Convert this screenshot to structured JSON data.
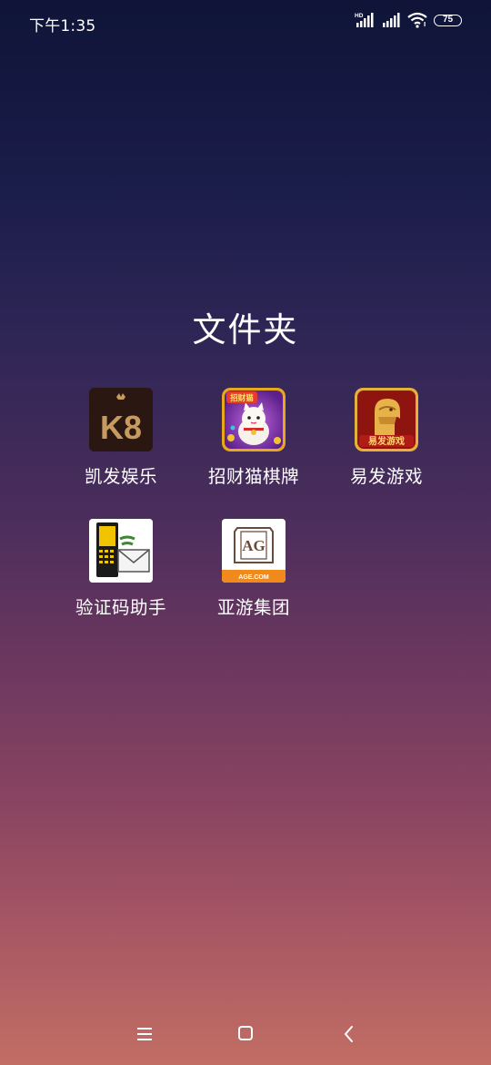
{
  "status_bar": {
    "time": "下午1:35",
    "network_label": "HD",
    "battery_level": "75",
    "icons": [
      "signal-hd-icon",
      "signal-icon",
      "wifi-icon",
      "battery-icon"
    ]
  },
  "folder": {
    "title": "文件夹",
    "apps": [
      {
        "label": "凯发娱乐",
        "icon": "k8-icon"
      },
      {
        "label": "招财猫棋牌",
        "icon": "lucky-cat-icon"
      },
      {
        "label": "易发游戏",
        "icon": "lion-icon"
      },
      {
        "label": "验证码助手",
        "icon": "sms-phone-icon"
      },
      {
        "label": "亚游集团",
        "icon": "ag-icon"
      }
    ]
  },
  "icon_text": {
    "k8": "K8",
    "ag": "AG",
    "ag_site": "AGE.COM",
    "lion_banner": "易发游戏",
    "cat_banner": "招财猫"
  },
  "nav_bar": {
    "buttons": [
      "menu-icon",
      "home-icon",
      "back-icon"
    ]
  }
}
